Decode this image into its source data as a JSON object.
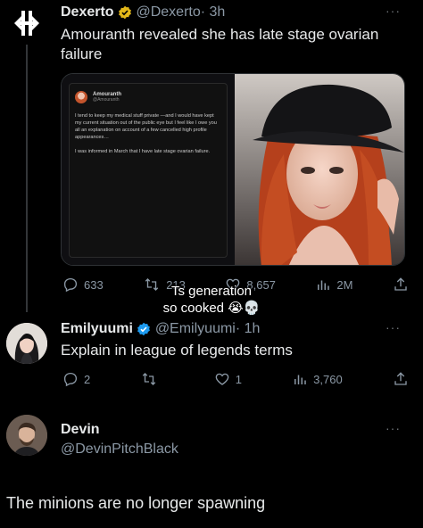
{
  "tweet1": {
    "author": "Dexerto",
    "handle": "@Dexerto",
    "time": "· 3h",
    "text": "Amouranth revealed she has late stage ovarian failure",
    "screenshot": {
      "name": "Amouranth",
      "handle": "@Amouranth",
      "para1": "I tend to keep my medical stuff private —and I would have kept my current situation out of the public eye but I feel like I owe you all an explanation on account of a few cancelled high profile appearances…",
      "para2": "I was informed in March that I have late stage ovarian failure."
    },
    "actions": {
      "replies": "633",
      "retweets": "213",
      "likes": "8,657",
      "views": "2M"
    }
  },
  "caption": {
    "line1": "Ts generation",
    "line2": "so cooked 😭💀"
  },
  "tweet2": {
    "author": "Emilyuumi",
    "handle": "@Emilyuumi",
    "time": "· 1h",
    "text": "Explain in league of legends terms",
    "actions": {
      "replies": "2",
      "retweets": "",
      "likes": "1",
      "views": "3,760"
    }
  },
  "tweet3": {
    "author": "Devin",
    "handle": "@DevinPitchBlack"
  },
  "reply_text": "The minions are no longer spawning",
  "icons": {
    "more": "more-dots-icon",
    "reply": "reply-icon",
    "retweet": "retweet-icon",
    "like": "heart-icon",
    "views": "views-icon",
    "share": "share-icon",
    "verified": "verified-badge-icon"
  },
  "colors": {
    "background": "#000000",
    "text": "#e7e9ea",
    "muted": "#8b98a5",
    "verified_gold": "#e2b719",
    "verified_blue": "#1d9bf0"
  }
}
